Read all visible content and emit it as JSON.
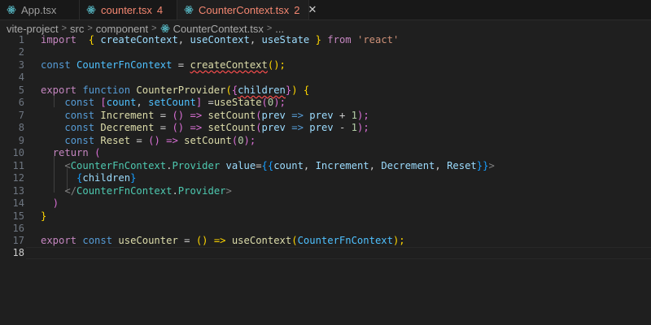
{
  "tabs": [
    {
      "name": "App.tsx",
      "count": "",
      "close": ""
    },
    {
      "name": "counter.tsx",
      "count": "4",
      "close": ""
    },
    {
      "name": "CounterContext.tsx",
      "count": "2",
      "close": "✕"
    }
  ],
  "breadcrumb": [
    "vite-project",
    "src",
    "component",
    "CounterContext.tsx",
    "..."
  ],
  "line_numbers": [
    "1",
    "2",
    "3",
    "4",
    "5",
    "6",
    "7",
    "8",
    "9",
    "10",
    "11",
    "12",
    "13",
    "14",
    "15",
    "16",
    "17",
    "18"
  ],
  "code": {
    "l1": {
      "import": "import",
      "ob": "{",
      "a": "createContext",
      "c1": ",",
      "b": "useContext",
      "c2": ",",
      "cc": "useState",
      "cb": "}",
      "from": "from",
      "mod": "'react'"
    },
    "l3": {
      "const": "const",
      "name": "CounterFnContext",
      "eq": "=",
      "fn": "createContext",
      "paren": "();"
    },
    "l5": {
      "export": "export",
      "function": "function",
      "name": "CounterProvider",
      "op": "(",
      "ob": "{",
      "arg": "children",
      "cb": "}",
      "cp": ")",
      "brace": "{"
    },
    "l6": {
      "const": "const",
      "ob": "[",
      "a": "count",
      "comma": ",",
      "b": "setCount",
      "cb": "]",
      "eq": "=",
      "fn": "useState",
      "op": "(",
      "zero": "0",
      "cp": ");"
    },
    "l7": {
      "const": "const",
      "name": "Increment",
      "eq": "=",
      "arrow1": "() =>",
      "fn": "setCount",
      "op": "(",
      "p1": "prev",
      "arrow": "=>",
      "p2": "prev",
      "plus": "+",
      "one": "1",
      "cp": ");"
    },
    "l8": {
      "const": "const",
      "name": "Decrement",
      "eq": "=",
      "arrow1": "() =>",
      "fn": "setCount",
      "op": "(",
      "p1": "prev",
      "arrow": "=>",
      "p2": "prev",
      "minus": "-",
      "one": "1",
      "cp": ");"
    },
    "l9": {
      "const": "const",
      "name": "Reset",
      "eq": "=",
      "arrow1": "() =>",
      "fn": "setCount",
      "op": "(",
      "zero": "0",
      "cp": ");"
    },
    "l10": {
      "return": "return",
      "op": "("
    },
    "l11": {
      "lt": "<",
      "comp": "CounterFnContext",
      "dot": ".",
      "prov": "Provider",
      "attr": "value",
      "eq": "=",
      "ob": "{{",
      "a": "count",
      "b": "Increment",
      "c": "Decrement",
      "d": "Reset",
      "cb": "}}",
      "gt": ">",
      "comma": ","
    },
    "l12": {
      "ob": "{",
      "arg": "children",
      "cb": "}"
    },
    "l13": {
      "lt": "</",
      "comp": "CounterFnContext",
      "dot": ".",
      "prov": "Provider",
      "gt": ">"
    },
    "l14": {
      "cp": ")"
    },
    "l15": {
      "brace": "}"
    },
    "l17": {
      "export": "export",
      "const": "const",
      "name": "useCounter",
      "eq": "=",
      "arrow1": "() =>",
      "fn": "useContext",
      "op": "(",
      "arg": "CounterFnContext",
      "cp": ");"
    }
  },
  "colors": {
    "background": "#1f1f1f",
    "keyword": "#569cd6",
    "function": "#dcdcaa",
    "string": "#ce9178",
    "error": "#f14c4c"
  },
  "icons": {
    "tab_icon": "react-gear-icon",
    "breadcrumb_icon": "react-gear-icon"
  }
}
